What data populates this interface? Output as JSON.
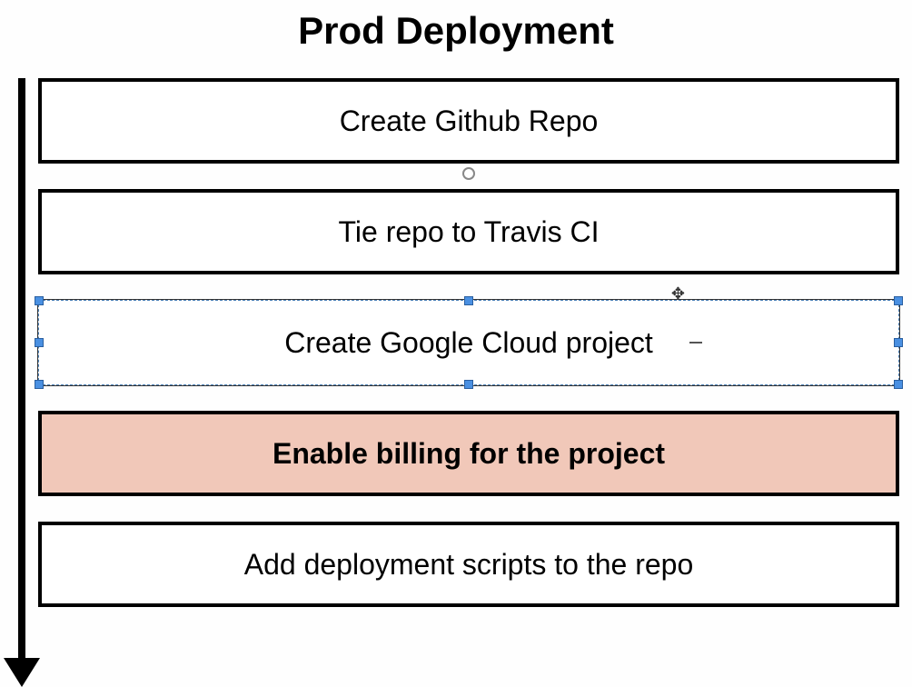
{
  "title": "Prod Deployment",
  "steps": [
    {
      "label": "Create Github Repo",
      "selected": false,
      "highlighted": false
    },
    {
      "label": "Tie repo to Travis CI",
      "selected": false,
      "highlighted": false
    },
    {
      "label": "Create Google Cloud project",
      "selected": true,
      "highlighted": false
    },
    {
      "label": "Enable billing for the project",
      "selected": false,
      "highlighted": true
    },
    {
      "label": "Add deployment scripts to the repo",
      "selected": false,
      "highlighted": false
    }
  ]
}
